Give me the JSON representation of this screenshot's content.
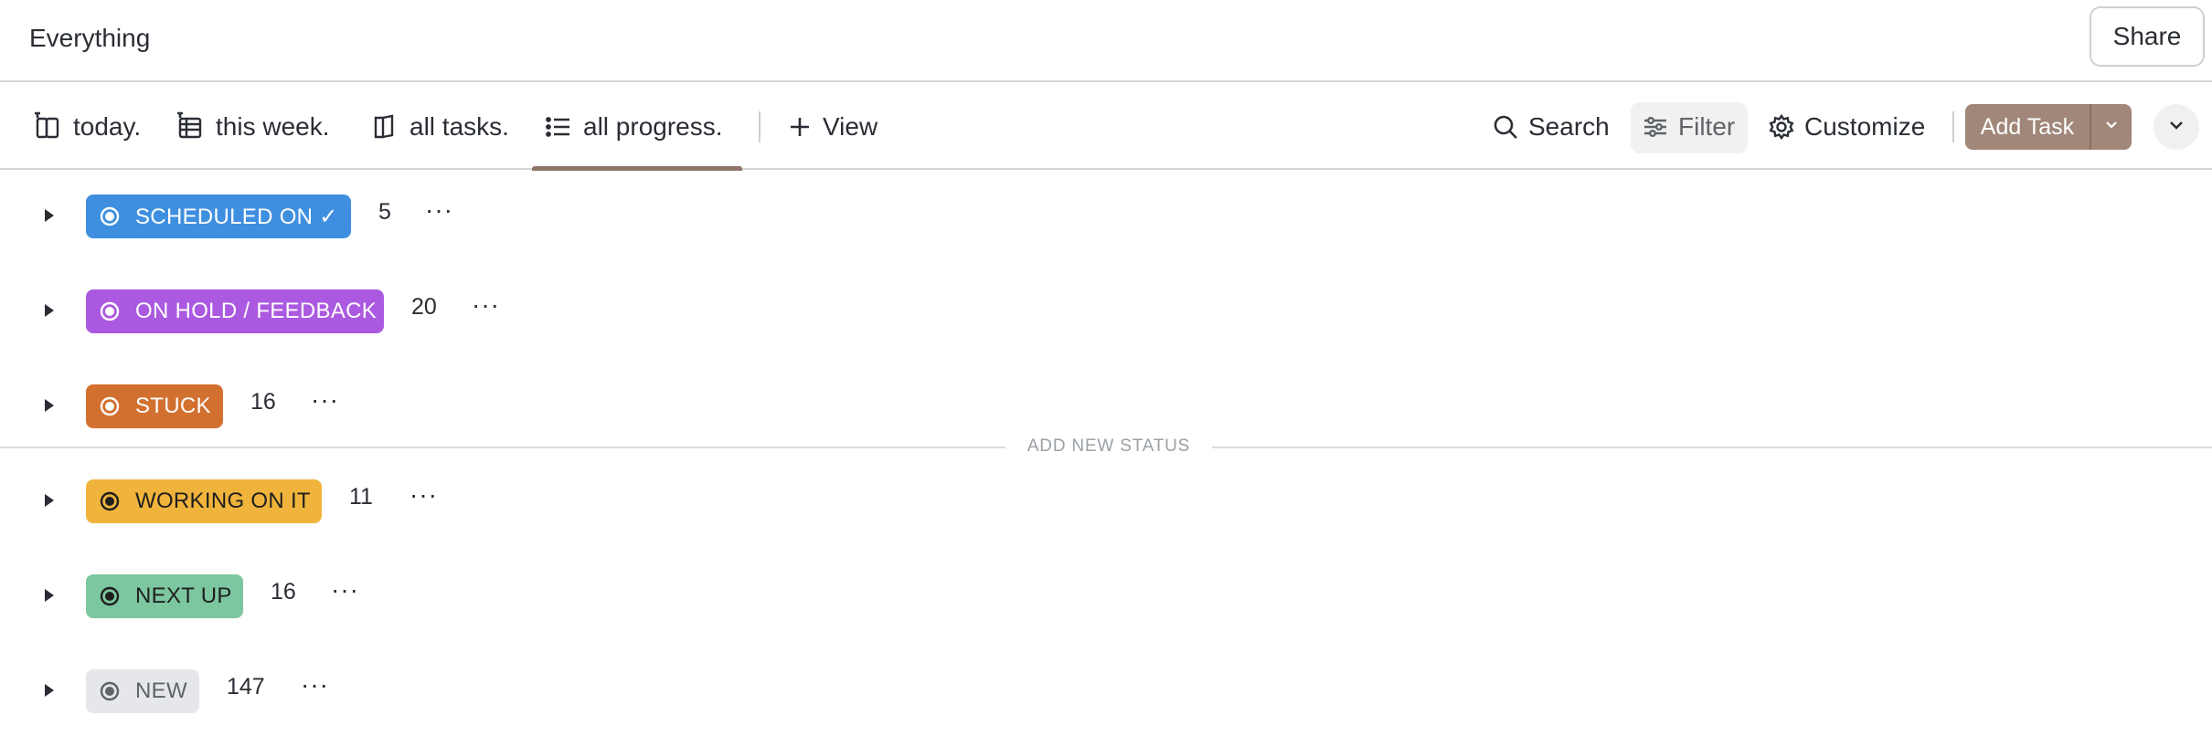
{
  "header": {
    "title": "Everything",
    "share_label": "Share"
  },
  "toolbar": {
    "tabs": [
      {
        "label": "today.",
        "icon": "board-icon"
      },
      {
        "label": "this week.",
        "icon": "table-icon"
      },
      {
        "label": "all tasks.",
        "icon": "doc-icon"
      },
      {
        "label": "all progress.",
        "icon": "list-icon",
        "active": true
      }
    ],
    "view_label": "View",
    "search_label": "Search",
    "filter_label": "Filter",
    "customize_label": "Customize",
    "add_task_label": "Add Task"
  },
  "groups": [
    {
      "label": "SCHEDULED ON ✓",
      "count": "5",
      "color": "#3f8fe0",
      "text_color": "#ffffff"
    },
    {
      "label": "ON HOLD / FEEDBACK",
      "count": "20",
      "color": "#ab59e0",
      "text_color": "#ffffff"
    },
    {
      "label": "STUCK",
      "count": "16",
      "color": "#d2702f",
      "text_color": "#ffffff"
    },
    {
      "label": "WORKING ON IT",
      "count": "11",
      "color": "#f0b43c",
      "text_color": "#1f1f1f"
    },
    {
      "label": "NEXT UP",
      "count": "16",
      "color": "#7cc6a0",
      "text_color": "#1f1f1f"
    },
    {
      "label": "NEW",
      "count": "147",
      "color": "#e6e7ea",
      "text_color": "#5f6368"
    }
  ],
  "divider": {
    "label": "ADD NEW STATUS"
  }
}
